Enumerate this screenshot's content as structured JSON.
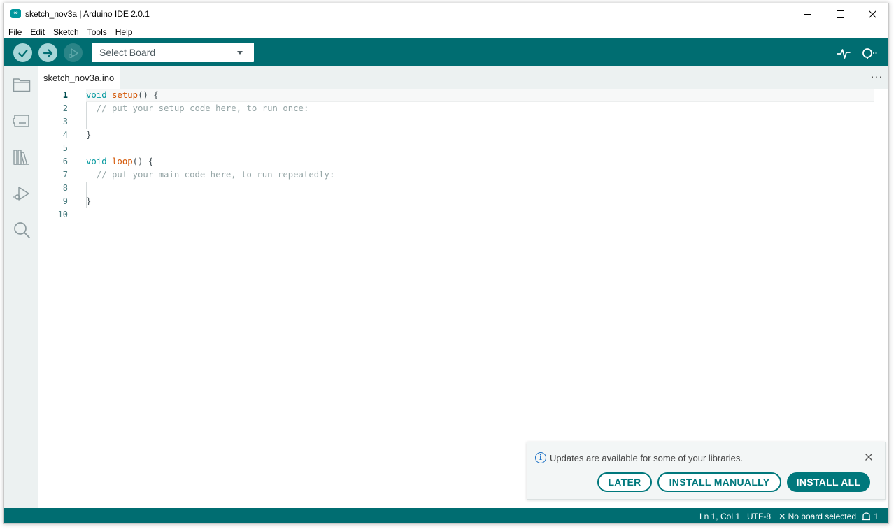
{
  "window": {
    "title": "sketch_nov3a | Arduino IDE 2.0.1",
    "app_icon_glyph": "∞"
  },
  "menu": {
    "items": [
      {
        "label": "File"
      },
      {
        "label": "Edit"
      },
      {
        "label": "Sketch"
      },
      {
        "label": "Tools"
      },
      {
        "label": "Help"
      }
    ]
  },
  "toolbar": {
    "board_select": "Select Board"
  },
  "tabs": {
    "active": "sketch_nov3a.ino",
    "more": "···"
  },
  "editor": {
    "lines": [
      "1",
      "2",
      "3",
      "4",
      "5",
      "6",
      "7",
      "8",
      "9",
      "10"
    ],
    "code": {
      "l1_kw": "void",
      "l1_fn": "setup",
      "l1_rest": "() {",
      "l2": "  // put your setup code here, to run once:",
      "l4": "}",
      "l6_kw": "void",
      "l6_fn": "loop",
      "l6_rest": "() {",
      "l7": "  // put your main code here, to run repeatedly:",
      "l9": "}"
    }
  },
  "notification": {
    "message": "Updates are available for some of your libraries.",
    "later": "LATER",
    "install_manually": "INSTALL MANUALLY",
    "install_all": "INSTALL ALL"
  },
  "status": {
    "position": "Ln 1, Col 1",
    "encoding": "UTF-8",
    "board": "✕ No board selected",
    "notifications_count": "1"
  },
  "colors": {
    "accent": "#006d71",
    "keyword": "#00979d",
    "function": "#d35400",
    "comment": "#95a5a6"
  }
}
